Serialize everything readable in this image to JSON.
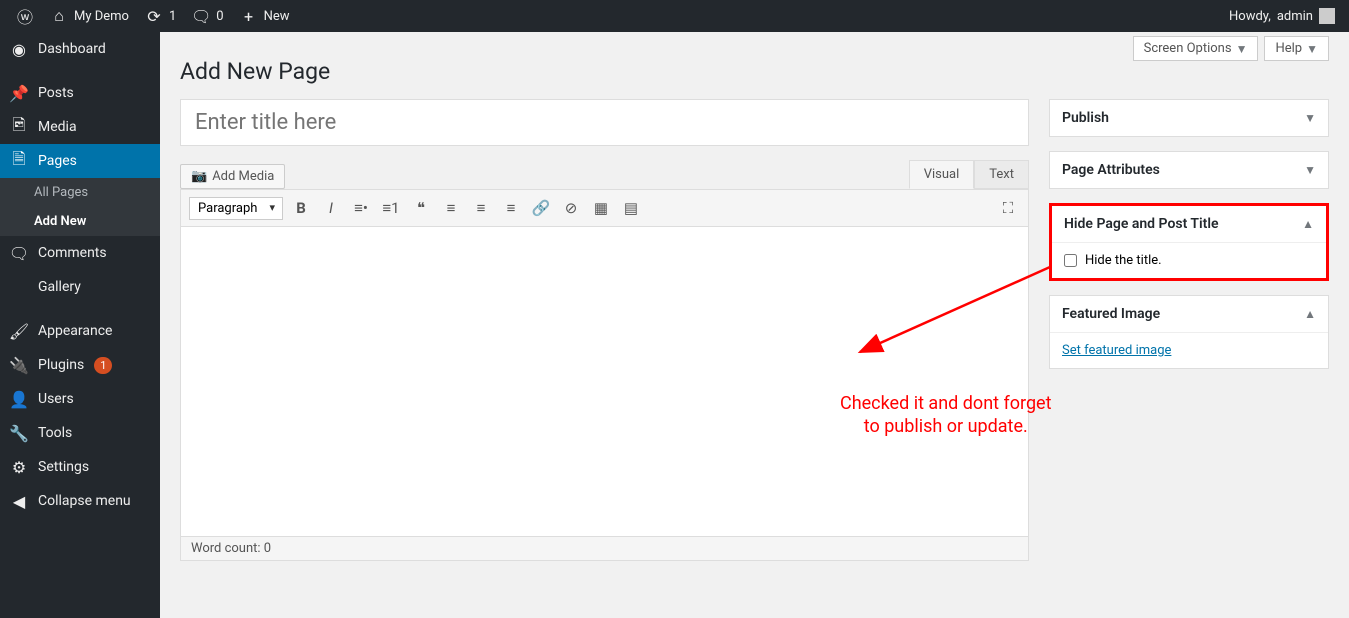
{
  "adminbar": {
    "site_name": "My Demo",
    "refresh_count": "1",
    "comment_count": "0",
    "new_label": "New",
    "howdy_prefix": "Howdy, ",
    "user": "admin"
  },
  "sidebar": {
    "dashboard": "Dashboard",
    "posts": "Posts",
    "media": "Media",
    "pages": "Pages",
    "pages_sub_all": "All Pages",
    "pages_sub_add": "Add New",
    "comments": "Comments",
    "gallery": "Gallery",
    "appearance": "Appearance",
    "plugins": "Plugins",
    "plugins_badge": "1",
    "users": "Users",
    "tools": "Tools",
    "settings": "Settings",
    "collapse": "Collapse menu"
  },
  "topbar": {
    "screen_options": "Screen Options",
    "help": "Help"
  },
  "heading": "Add New Page",
  "title_placeholder": "Enter title here",
  "editor": {
    "add_media": "Add Media",
    "tab_visual": "Visual",
    "tab_text": "Text",
    "paragraph": "Paragraph",
    "word_count": "Word count: 0"
  },
  "metaboxes": {
    "publish": "Publish",
    "page_attr": "Page Attributes",
    "hide_title_head": "Hide Page and Post Title",
    "hide_title_label": "Hide the title.",
    "featured_head": "Featured Image",
    "featured_link": "Set featured image"
  },
  "annotation": {
    "line1": "Checked it and dont forget",
    "line2": "to publish or update."
  }
}
